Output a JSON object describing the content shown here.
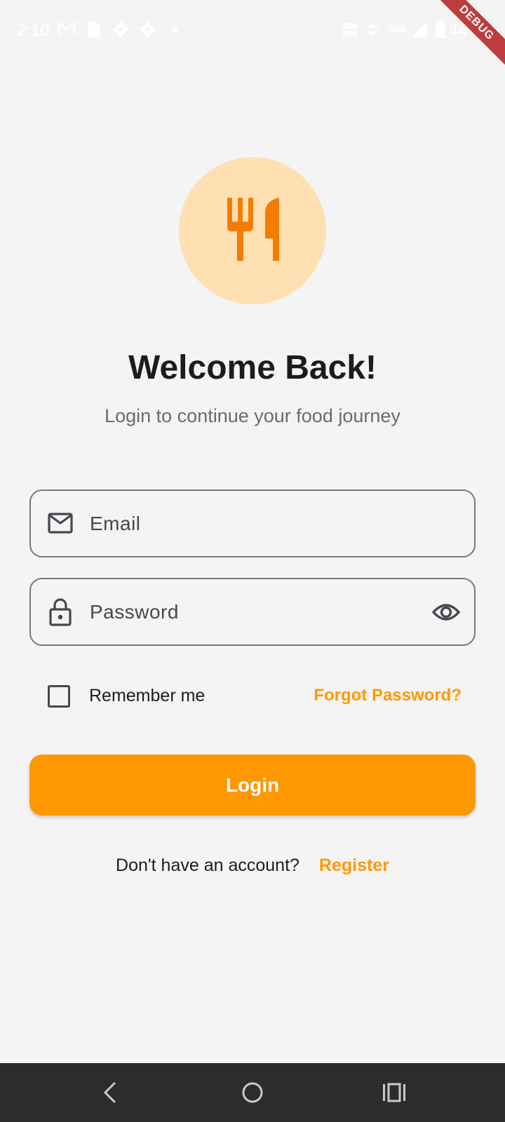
{
  "status_bar": {
    "time": "2:10",
    "battery_percent": "44",
    "icons": [
      "gmail-icon",
      "file-icon",
      "settings-icon",
      "settings-icon",
      "dot-icon",
      "volte-icon",
      "data-arrows-icon",
      "5g-icon",
      "signal-icon",
      "battery-icon"
    ]
  },
  "debug_banner": "DEBUG",
  "logo": {
    "icon": "restaurant-icon",
    "bg_color": "#ffe0b2",
    "icon_color": "#f57c00"
  },
  "header": {
    "title": "Welcome Back!",
    "subtitle": "Login to continue your food journey"
  },
  "form": {
    "email": {
      "placeholder": "Email",
      "value": "",
      "icon": "mail-icon"
    },
    "password": {
      "placeholder": "Password",
      "value": "",
      "icon": "lock-icon",
      "toggle_icon": "eye-icon"
    },
    "remember_label": "Remember me",
    "remember_checked": false,
    "forgot_label": "Forgot Password?",
    "login_label": "Login"
  },
  "register": {
    "question": "Don't have an account?",
    "link_label": "Register"
  },
  "colors": {
    "accent": "#ff9800",
    "background": "#f4f4f5",
    "nav_bar": "#2c2c2e"
  },
  "nav_bar": {
    "icons": [
      "back-icon",
      "home-icon",
      "recents-icon"
    ]
  }
}
